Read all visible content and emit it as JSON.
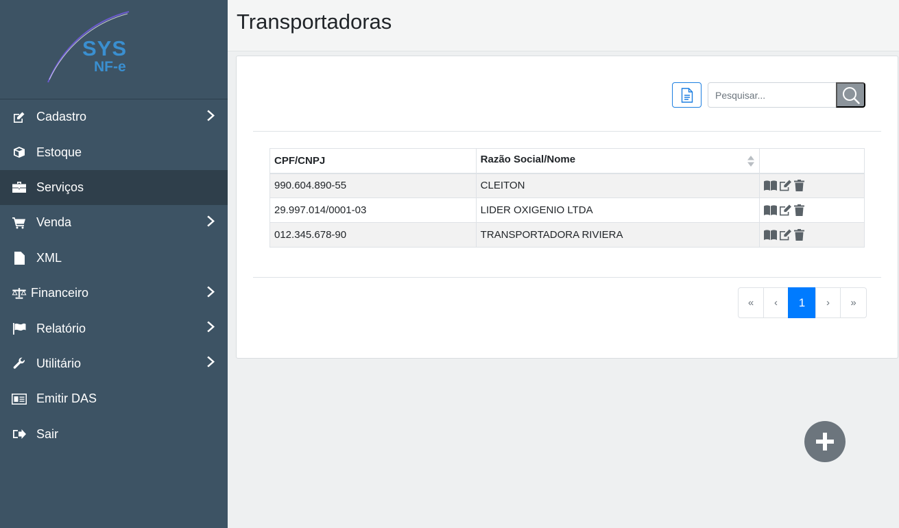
{
  "brand": {
    "line1": "SYS",
    "line2": "NF-e"
  },
  "sidebar": {
    "items": [
      {
        "label": "Cadastro",
        "icon": "edit-icon",
        "has_submenu": true
      },
      {
        "label": "Estoque",
        "icon": "cube-icon",
        "has_submenu": false
      },
      {
        "label": "Serviços",
        "icon": "briefcase-icon",
        "has_submenu": false,
        "active": true
      },
      {
        "label": "Venda",
        "icon": "cart-icon",
        "has_submenu": true
      },
      {
        "label": "XML",
        "icon": "file-icon",
        "has_submenu": false
      },
      {
        "label": "Financeiro",
        "icon": "balance-scale-icon",
        "has_submenu": true
      },
      {
        "label": "Relatório",
        "icon": "flag-icon",
        "has_submenu": true
      },
      {
        "label": "Utilitário",
        "icon": "wrench-icon",
        "has_submenu": true
      },
      {
        "label": "Emitir DAS",
        "icon": "id-card-icon",
        "has_submenu": false
      },
      {
        "label": "Sair",
        "icon": "sign-out-icon",
        "has_submenu": false
      }
    ]
  },
  "header": {
    "title": "Transportadoras"
  },
  "toolbar": {
    "search_placeholder": "Pesquisar..."
  },
  "table": {
    "columns": [
      "CPF/CNPJ",
      "Razão Social/Nome",
      ""
    ],
    "rows": [
      {
        "cpf_cnpj": "990.604.890-55",
        "nome": "CLEITON"
      },
      {
        "cpf_cnpj": "29.997.014/0001-03",
        "nome": "LIDER OXIGENIO LTDA"
      },
      {
        "cpf_cnpj": "012.345.678-90",
        "nome": "TRANSPORTADORA RIVIERA"
      }
    ]
  },
  "pagination": {
    "first": "«",
    "prev": "‹",
    "current": "1",
    "next": "›",
    "last": "»"
  },
  "colors": {
    "sidebar_bg": "#3d5364",
    "sidebar_active": "#2f3f4b",
    "accent": "#007bff",
    "brand": "#3a8fd0"
  }
}
